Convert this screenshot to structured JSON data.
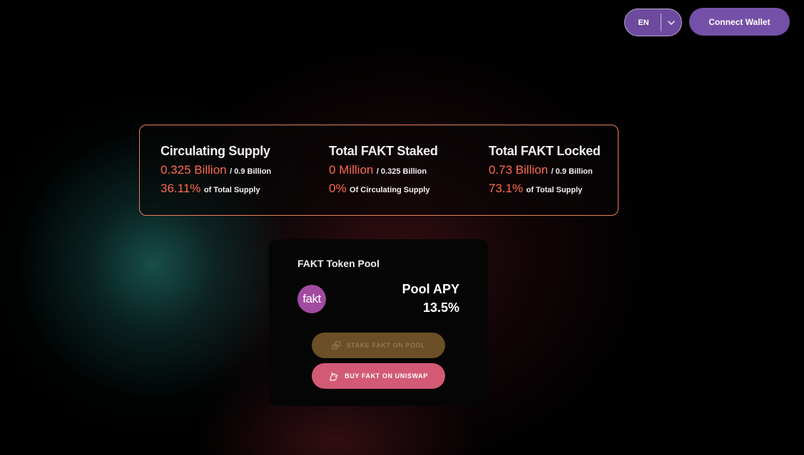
{
  "header": {
    "language": {
      "selected": "EN"
    },
    "connect_wallet_label": "Connect Wallet"
  },
  "stats": [
    {
      "title": "Circulating Supply",
      "amount": "0.325 Billion",
      "amount_suffix": "/ 0.9 Billion",
      "percent": "36.11%",
      "percent_suffix": "of Total Supply"
    },
    {
      "title": "Total FAKT Staked",
      "amount": "0 Million",
      "amount_suffix": "/ 0.325 Billion",
      "percent": "0%",
      "percent_suffix": "Of Circulating Supply"
    },
    {
      "title": "Total FAKT Locked",
      "amount": "0.73 Billion",
      "amount_suffix": "/ 0.9 Billion",
      "percent": "73.1%",
      "percent_suffix": "of Total Supply"
    }
  ],
  "pool": {
    "title": "FAKT Token Pool",
    "logo_text": "fakt",
    "apy_label": "Pool APY",
    "apy_value": "13.5%",
    "stake_button_label": "STAKE FAKT ON POOL",
    "buy_button_label": "BUY FAKT ON UNISWAP"
  },
  "colors": {
    "accent": "#ff6a4f",
    "brand_purple": "#7550a8",
    "stake_button": "#6b4f26",
    "buy_button": "#d35a75",
    "card_border": "#e8805e"
  },
  "icons": {
    "language_chevron": "chevron-down-icon",
    "stake": "coins-stack-icon",
    "buy": "unicorn-icon"
  }
}
